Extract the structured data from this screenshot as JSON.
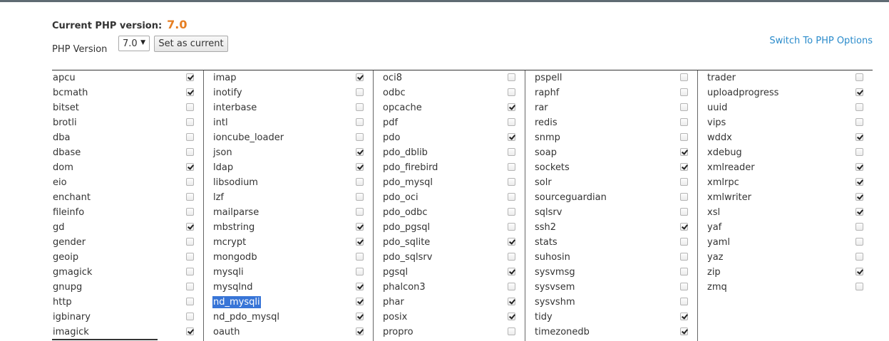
{
  "header": {
    "current_label": "Current PHP version:",
    "current_value": "7.0",
    "php_version_label": "PHP Version",
    "select_value": "7.0",
    "set_current_label": "Set as current",
    "switch_link": "Switch To PHP Options"
  },
  "colors": {
    "accent_version": "#e67e22",
    "link": "#2a8bcb",
    "selection": "#3875d7"
  },
  "extensions": [
    [
      {
        "name": "apcu",
        "checked": true
      },
      {
        "name": "bcmath",
        "checked": true
      },
      {
        "name": "bitset",
        "checked": false
      },
      {
        "name": "brotli",
        "checked": false
      },
      {
        "name": "dba",
        "checked": false
      },
      {
        "name": "dbase",
        "checked": false
      },
      {
        "name": "dom",
        "checked": true
      },
      {
        "name": "eio",
        "checked": false
      },
      {
        "name": "enchant",
        "checked": false
      },
      {
        "name": "fileinfo",
        "checked": false
      },
      {
        "name": "gd",
        "checked": true
      },
      {
        "name": "gender",
        "checked": false
      },
      {
        "name": "geoip",
        "checked": false
      },
      {
        "name": "gmagick",
        "checked": false
      },
      {
        "name": "gnupg",
        "checked": false
      },
      {
        "name": "http",
        "checked": false
      },
      {
        "name": "igbinary",
        "checked": false
      },
      {
        "name": "imagick",
        "checked": true
      }
    ],
    [
      {
        "name": "imap",
        "checked": true
      },
      {
        "name": "inotify",
        "checked": false
      },
      {
        "name": "interbase",
        "checked": false
      },
      {
        "name": "intl",
        "checked": false
      },
      {
        "name": "ioncube_loader",
        "checked": false
      },
      {
        "name": "json",
        "checked": true
      },
      {
        "name": "ldap",
        "checked": true
      },
      {
        "name": "libsodium",
        "checked": false
      },
      {
        "name": "lzf",
        "checked": false
      },
      {
        "name": "mailparse",
        "checked": false
      },
      {
        "name": "mbstring",
        "checked": true
      },
      {
        "name": "mcrypt",
        "checked": true
      },
      {
        "name": "mongodb",
        "checked": false
      },
      {
        "name": "mysqli",
        "checked": false
      },
      {
        "name": "mysqlnd",
        "checked": true
      },
      {
        "name": "nd_mysqli",
        "checked": true,
        "selected": true
      },
      {
        "name": "nd_pdo_mysql",
        "checked": true
      },
      {
        "name": "oauth",
        "checked": true
      }
    ],
    [
      {
        "name": "oci8",
        "checked": false
      },
      {
        "name": "odbc",
        "checked": false
      },
      {
        "name": "opcache",
        "checked": true
      },
      {
        "name": "pdf",
        "checked": false
      },
      {
        "name": "pdo",
        "checked": true
      },
      {
        "name": "pdo_dblib",
        "checked": false
      },
      {
        "name": "pdo_firebird",
        "checked": false
      },
      {
        "name": "pdo_mysql",
        "checked": false
      },
      {
        "name": "pdo_oci",
        "checked": false
      },
      {
        "name": "pdo_odbc",
        "checked": false
      },
      {
        "name": "pdo_pgsql",
        "checked": false
      },
      {
        "name": "pdo_sqlite",
        "checked": true
      },
      {
        "name": "pdo_sqlsrv",
        "checked": false
      },
      {
        "name": "pgsql",
        "checked": true
      },
      {
        "name": "phalcon3",
        "checked": false
      },
      {
        "name": "phar",
        "checked": true
      },
      {
        "name": "posix",
        "checked": true
      },
      {
        "name": "propro",
        "checked": false
      }
    ],
    [
      {
        "name": "pspell",
        "checked": false
      },
      {
        "name": "raphf",
        "checked": false
      },
      {
        "name": "rar",
        "checked": false
      },
      {
        "name": "redis",
        "checked": false
      },
      {
        "name": "snmp",
        "checked": false
      },
      {
        "name": "soap",
        "checked": true
      },
      {
        "name": "sockets",
        "checked": true
      },
      {
        "name": "solr",
        "checked": false
      },
      {
        "name": "sourceguardian",
        "checked": false
      },
      {
        "name": "sqlsrv",
        "checked": false
      },
      {
        "name": "ssh2",
        "checked": true
      },
      {
        "name": "stats",
        "checked": false
      },
      {
        "name": "suhosin",
        "checked": false
      },
      {
        "name": "sysvmsg",
        "checked": false
      },
      {
        "name": "sysvsem",
        "checked": false
      },
      {
        "name": "sysvshm",
        "checked": false
      },
      {
        "name": "tidy",
        "checked": true
      },
      {
        "name": "timezonedb",
        "checked": true
      }
    ],
    [
      {
        "name": "trader",
        "checked": false
      },
      {
        "name": "uploadprogress",
        "checked": true
      },
      {
        "name": "uuid",
        "checked": false
      },
      {
        "name": "vips",
        "checked": false
      },
      {
        "name": "wddx",
        "checked": true
      },
      {
        "name": "xdebug",
        "checked": false
      },
      {
        "name": "xmlreader",
        "checked": true
      },
      {
        "name": "xmlrpc",
        "checked": true
      },
      {
        "name": "xmlwriter",
        "checked": true
      },
      {
        "name": "xsl",
        "checked": true
      },
      {
        "name": "yaf",
        "checked": false
      },
      {
        "name": "yaml",
        "checked": false
      },
      {
        "name": "yaz",
        "checked": false
      },
      {
        "name": "zip",
        "checked": true
      },
      {
        "name": "zmq",
        "checked": false
      }
    ]
  ]
}
